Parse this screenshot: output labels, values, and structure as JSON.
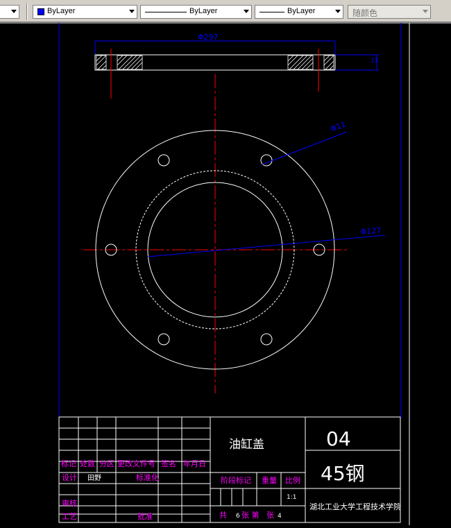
{
  "toolbar": {
    "color_value": "ByLayer",
    "color_swatch": "#0000ff",
    "linetype_value": "ByLayer",
    "lineweight_value": "ByLayer",
    "plotstyle_value": "随颜色"
  },
  "drawing": {
    "dim_top": "Φ297",
    "dim_hole": "Φ11",
    "dim_inner": "Φ127",
    "dim_right": "15",
    "colors": {
      "outline": "#ffffff",
      "center": "#ff0000",
      "dimension": "#0000ff",
      "label": "#ff00ff"
    }
  },
  "title_block": {
    "part_name": "油缸盖",
    "drawing_number": "04",
    "material": "45钢",
    "school": "湖北工业大学工程技术学院",
    "headers": {
      "mark": "标记",
      "count": "处数",
      "zone": "分区",
      "change_doc": "更改文件号",
      "signature": "签名",
      "date": "年月日",
      "design": "设计",
      "designer": "田野",
      "standardize": "标准化",
      "review": "审核",
      "process": "工艺",
      "approve": "批准",
      "stage_mark": "阶段标记",
      "weight": "重量",
      "scale_label": "比例",
      "scale": "1:1"
    },
    "sheets": {
      "total_label": "共",
      "total": "6",
      "sheets_label": "张 第",
      "current_label": "张",
      "current": "4"
    }
  }
}
